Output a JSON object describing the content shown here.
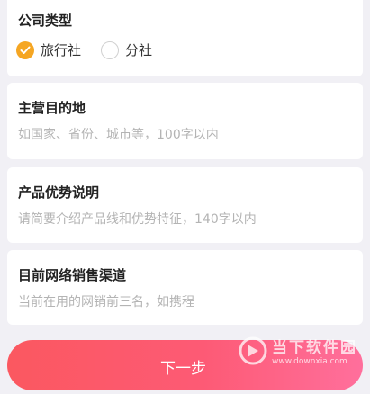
{
  "company_type": {
    "label": "公司类型",
    "options": [
      {
        "label": "旅行社",
        "checked": true
      },
      {
        "label": "分社",
        "checked": false
      }
    ]
  },
  "destination": {
    "label": "主营目的地",
    "placeholder": "如国家、省份、城市等，100字以内",
    "value": ""
  },
  "product_advantage": {
    "label": "产品优势说明",
    "placeholder": "请简要介绍产品线和优势特征，140字以内",
    "value": ""
  },
  "sales_channel": {
    "label": "目前网络销售渠道",
    "placeholder": "当前在用的网销前三名，如携程",
    "value": ""
  },
  "next_button": {
    "label": "下一步"
  },
  "watermark": {
    "name": "当下软件园",
    "url": "www.downxia.com"
  },
  "colors": {
    "accent_orange": "#f5a623",
    "button_gradient_start": "#fb5860",
    "button_gradient_end": "#ff6f9c",
    "background": "#f1f0f5",
    "placeholder": "#b4b4b4"
  }
}
